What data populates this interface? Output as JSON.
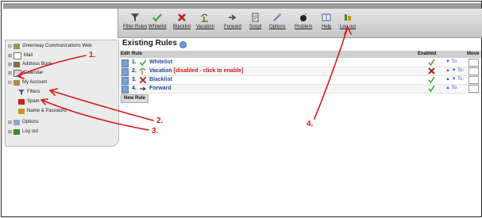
{
  "toolbar": {
    "items": [
      {
        "label": "Filter Rules",
        "icon": "filter-icon"
      },
      {
        "label": "Whitelist",
        "icon": "check-icon"
      },
      {
        "label": "Blacklist",
        "icon": "x-icon"
      },
      {
        "label": "Vacation",
        "icon": "vacation-icon"
      },
      {
        "label": "Forward",
        "icon": "forward-icon"
      },
      {
        "label": "Script",
        "icon": "script-icon"
      },
      {
        "label": "Options",
        "icon": "options-icon"
      },
      {
        "label": "Problem",
        "icon": "bomb-icon"
      },
      {
        "label": "Help",
        "icon": "help-icon"
      },
      {
        "label": "Log out",
        "icon": "logout-icon"
      }
    ]
  },
  "sidebar": {
    "items": [
      {
        "label": "Greenway Communications Web",
        "icon": "server-icon"
      },
      {
        "label": "Mail",
        "icon": "mail-icon"
      },
      {
        "label": "Address Book",
        "icon": "addressbook-icon"
      },
      {
        "label": "Calendar",
        "icon": "calendar-icon"
      },
      {
        "label": "My Account",
        "icon": "account-icon"
      },
      {
        "label": "Filters",
        "icon": "filter-icon"
      },
      {
        "label": "Spam",
        "icon": "spam-icon"
      },
      {
        "label": "Name & Password",
        "icon": "user-icon"
      },
      {
        "label": "Options",
        "icon": "options-icon"
      },
      {
        "label": "Log out",
        "icon": "logout-icon"
      }
    ]
  },
  "main": {
    "title": "Existing Rules",
    "columns": {
      "edit": "Edit",
      "rule": "Rule",
      "enabled": "Enabled",
      "move": "Move"
    },
    "rules": [
      {
        "num": "1.",
        "name": "Whitelist",
        "note": "",
        "icon": "check-icon",
        "enabled": true,
        "move": "To:"
      },
      {
        "num": "2.",
        "name": "Vacation",
        "note": "[disabled - click to enable]",
        "icon": "vacation-icon",
        "enabled": false,
        "move": "To:"
      },
      {
        "num": "3.",
        "name": "Blacklist",
        "note": "",
        "icon": "x-icon",
        "enabled": true,
        "move": "To:"
      },
      {
        "num": "4.",
        "name": "Forward",
        "note": "",
        "icon": "forward-icon",
        "enabled": true,
        "move": "To:"
      }
    ],
    "new_rule_label": "New Rule"
  },
  "annotations": [
    "1.",
    "2.",
    "3.",
    "4."
  ],
  "colors": {
    "annotation": "#d31a1a",
    "link": "#1f4d9a",
    "disabled": "#cc1a1a",
    "enabled": "#46a43a"
  }
}
